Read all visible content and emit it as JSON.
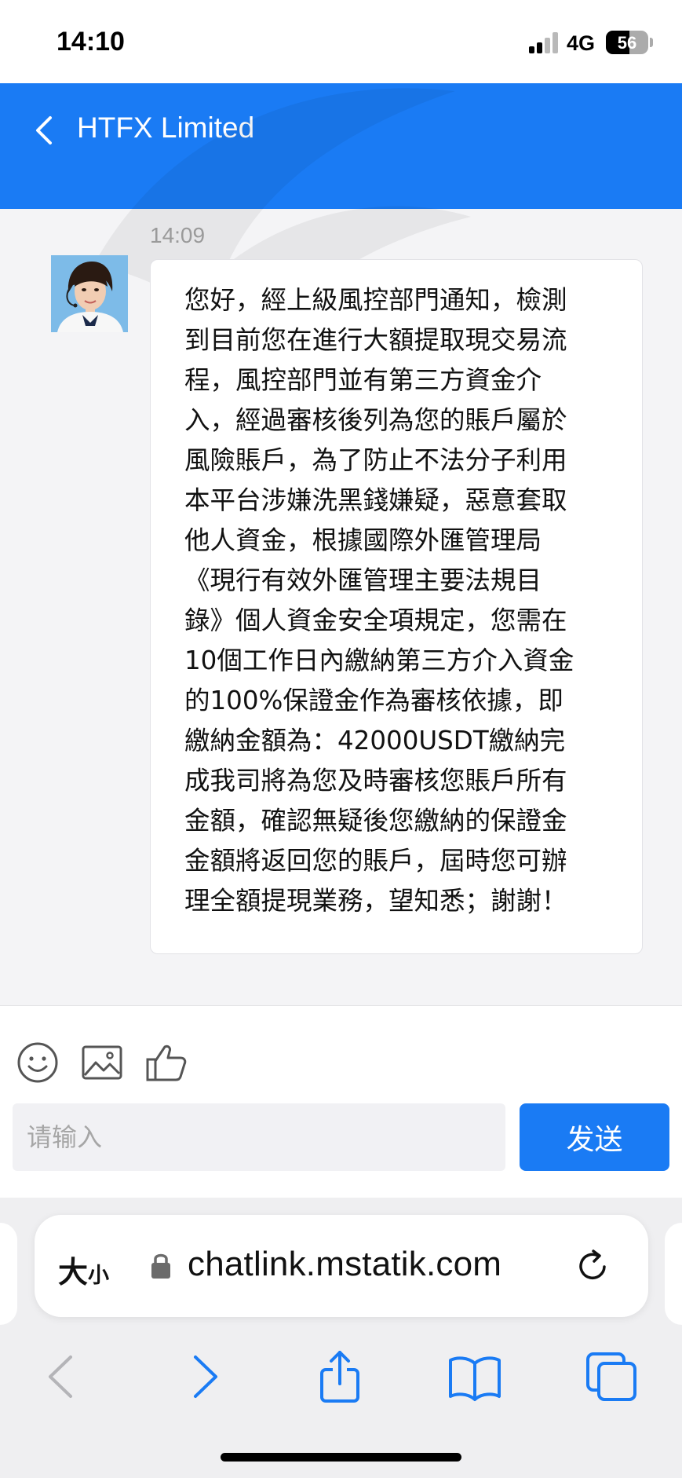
{
  "status_bar": {
    "time": "14:10",
    "network": "4G",
    "battery": "56"
  },
  "header": {
    "title": "HTFX Limited"
  },
  "chat": {
    "message_time": "14:09",
    "message_text": "您好，經上級風控部門通知，檢測\n到目前您在進行大額提取現交易流\n程，風控部門並有第三方資金介\n入，經過審核後列為您的賬戶屬於\n風險賬戶，為了防止不法分子利用\n本平台涉嫌洗黑錢嫌疑，惡意套取\n他人資金，根據國際外匯管理局\n《現行有效外匯管理主要法規目\n錄》個人資金安全項規定，您需在\n10個工作日內繳納第三方介入資金\n的100%保證金作為審核依據，即\n繳納金額為：42000USDT繳納完\n成我司將為您及時審核您賬戶所有\n金額，確認無疑後您繳納的保證金\n金額將返回您的賬戶，屆時您可辦\n理全額提現業務，望知悉；謝謝！"
  },
  "composer": {
    "placeholder": "请输入",
    "send_label": "发送"
  },
  "browser": {
    "text_size_big": "大",
    "text_size_small": "小",
    "url": "chatlink.mstatik.com"
  },
  "colors": {
    "accent": "#1a7bf4",
    "chat_background": "#f4f4f6",
    "bubble": "#ffffff",
    "ios_blue": "#1a7bf4"
  }
}
